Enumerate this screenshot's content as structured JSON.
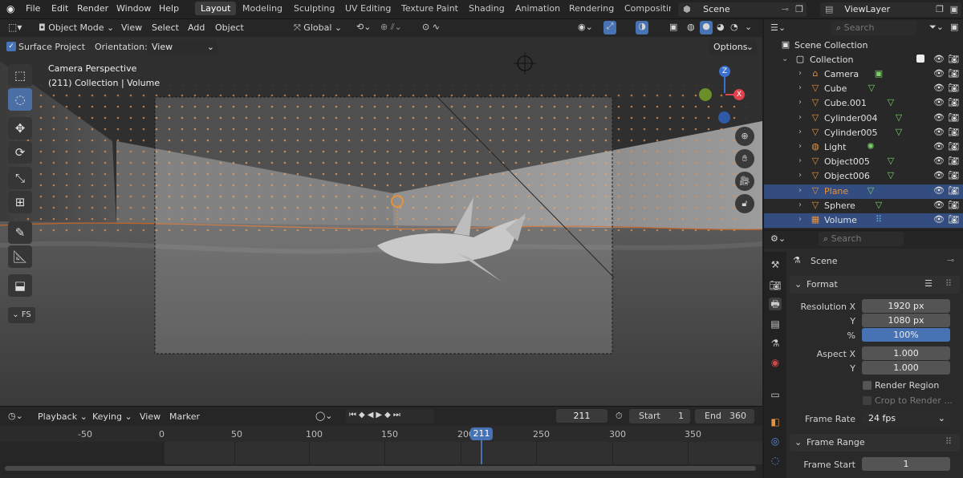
{
  "topbar": {
    "menus": [
      "File",
      "Edit",
      "Render",
      "Window",
      "Help"
    ],
    "workspaces": [
      "Layout",
      "Modeling",
      "Sculpting",
      "UV Editing",
      "Texture Paint",
      "Shading",
      "Animation",
      "Rendering",
      "Compositin"
    ],
    "active_workspace": "Layout",
    "scene": "Scene",
    "view_layer": "ViewLayer"
  },
  "viewport_header": {
    "mode": "Object Mode",
    "menus": [
      "View",
      "Select",
      "Add",
      "Object"
    ],
    "transform_orientation": "Global"
  },
  "tool_settings": {
    "surface_project": "Surface Project",
    "orientation_label": "Orientation:",
    "orientation_value": "View",
    "options": "Options"
  },
  "viewport": {
    "camera_label": "Camera Perspective",
    "collection_label": "(211) Collection | Volume",
    "fps_label": "FS",
    "gizmo": {
      "z": "Z",
      "x": "X"
    }
  },
  "outliner": {
    "search_placeholder": "Search",
    "scene_collection": "Scene Collection",
    "collection": "Collection",
    "items": [
      {
        "name": "Camera",
        "icon": "camera-icon"
      },
      {
        "name": "Cube",
        "icon": "mesh-icon"
      },
      {
        "name": "Cube.001",
        "icon": "mesh-icon"
      },
      {
        "name": "Cylinder004",
        "icon": "mesh-icon"
      },
      {
        "name": "Cylinder005",
        "icon": "mesh-icon"
      },
      {
        "name": "Light",
        "icon": "light-icon"
      },
      {
        "name": "Object005",
        "icon": "mesh-icon"
      },
      {
        "name": "Object006",
        "icon": "mesh-icon"
      },
      {
        "name": "Plane",
        "icon": "mesh-icon"
      },
      {
        "name": "Sphere",
        "icon": "mesh-icon"
      },
      {
        "name": "Volume",
        "icon": "volume-icon"
      }
    ]
  },
  "properties": {
    "search_placeholder": "Search",
    "context": "Scene",
    "format": {
      "title": "Format",
      "resolution_x_label": "Resolution X",
      "resolution_x": "1920 px",
      "y_label": "Y",
      "resolution_y": "1080 px",
      "pct_label": "%",
      "resolution_pct": "100%",
      "aspect_x_label": "Aspect X",
      "aspect_x": "1.000",
      "aspect_y_label": "Y",
      "aspect_y": "1.000",
      "render_region": "Render Region",
      "crop_to_render": "Crop to Render ...",
      "frame_rate_label": "Frame Rate",
      "frame_rate": "24 fps"
    },
    "frame_range": {
      "title": "Frame Range",
      "frame_start_label": "Frame Start",
      "frame_start": "1"
    }
  },
  "timeline": {
    "menus": [
      "Playback",
      "Keying",
      "View",
      "Marker"
    ],
    "current_frame": "211",
    "start_label": "Start",
    "start": "1",
    "end_label": "End",
    "end": "360",
    "ticks": [
      "-50",
      "0",
      "50",
      "100",
      "150",
      "200",
      "250",
      "300",
      "350"
    ],
    "playhead": "211"
  },
  "colors": {
    "accent": "#4772b3",
    "selection": "#334d80",
    "orange": "#e8913b"
  }
}
